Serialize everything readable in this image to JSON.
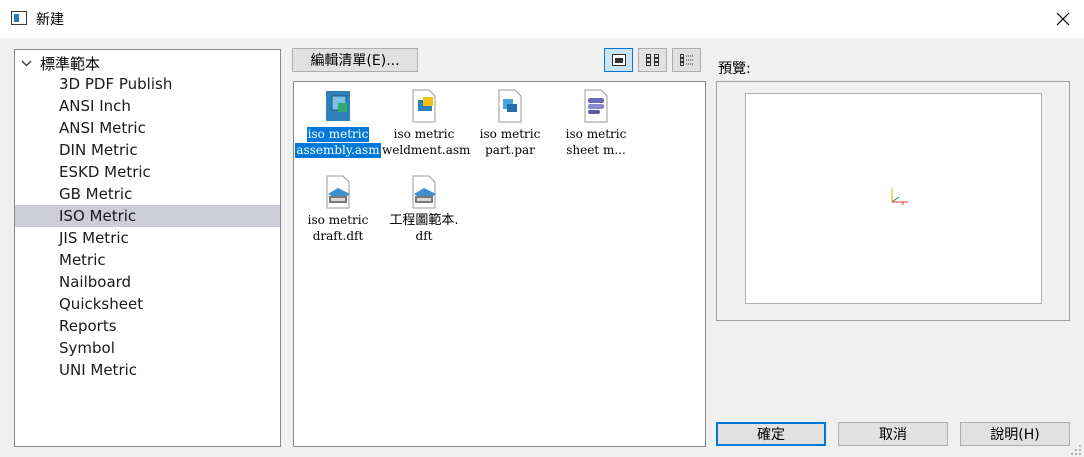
{
  "window": {
    "title": "新建"
  },
  "tree": {
    "root_label": "標準範本",
    "items": [
      "3D PDF Publish",
      "ANSI Inch",
      "ANSI Metric",
      "DIN Metric",
      "ESKD Metric",
      "GB Metric",
      "ISO Metric",
      "JIS Metric",
      "Metric",
      "Nailboard",
      "Quicksheet",
      "Reports",
      "Symbol",
      "UNI Metric"
    ],
    "selected": "ISO Metric"
  },
  "toolbar": {
    "edit_list_label": "編輯清單(E)..."
  },
  "files": [
    {
      "line1": "iso metric",
      "line2": "assembly.asm",
      "selected": true
    },
    {
      "line1": "iso metric",
      "line2": "weldment.asm"
    },
    {
      "line1": "iso metric",
      "line2": "part.par"
    },
    {
      "line1": "iso metric",
      "line2": "sheet m..."
    },
    {
      "line1": "iso metric",
      "line2": "draft.dft"
    },
    {
      "line1": "工程圖範本.",
      "line2": "dft"
    }
  ],
  "preview": {
    "label": "預覽:"
  },
  "buttons": {
    "ok": "確定",
    "cancel": "取消",
    "help": "說明(H)"
  },
  "colors": {
    "accent": "#0078d7",
    "tree_selection": "#cdcdd8"
  }
}
